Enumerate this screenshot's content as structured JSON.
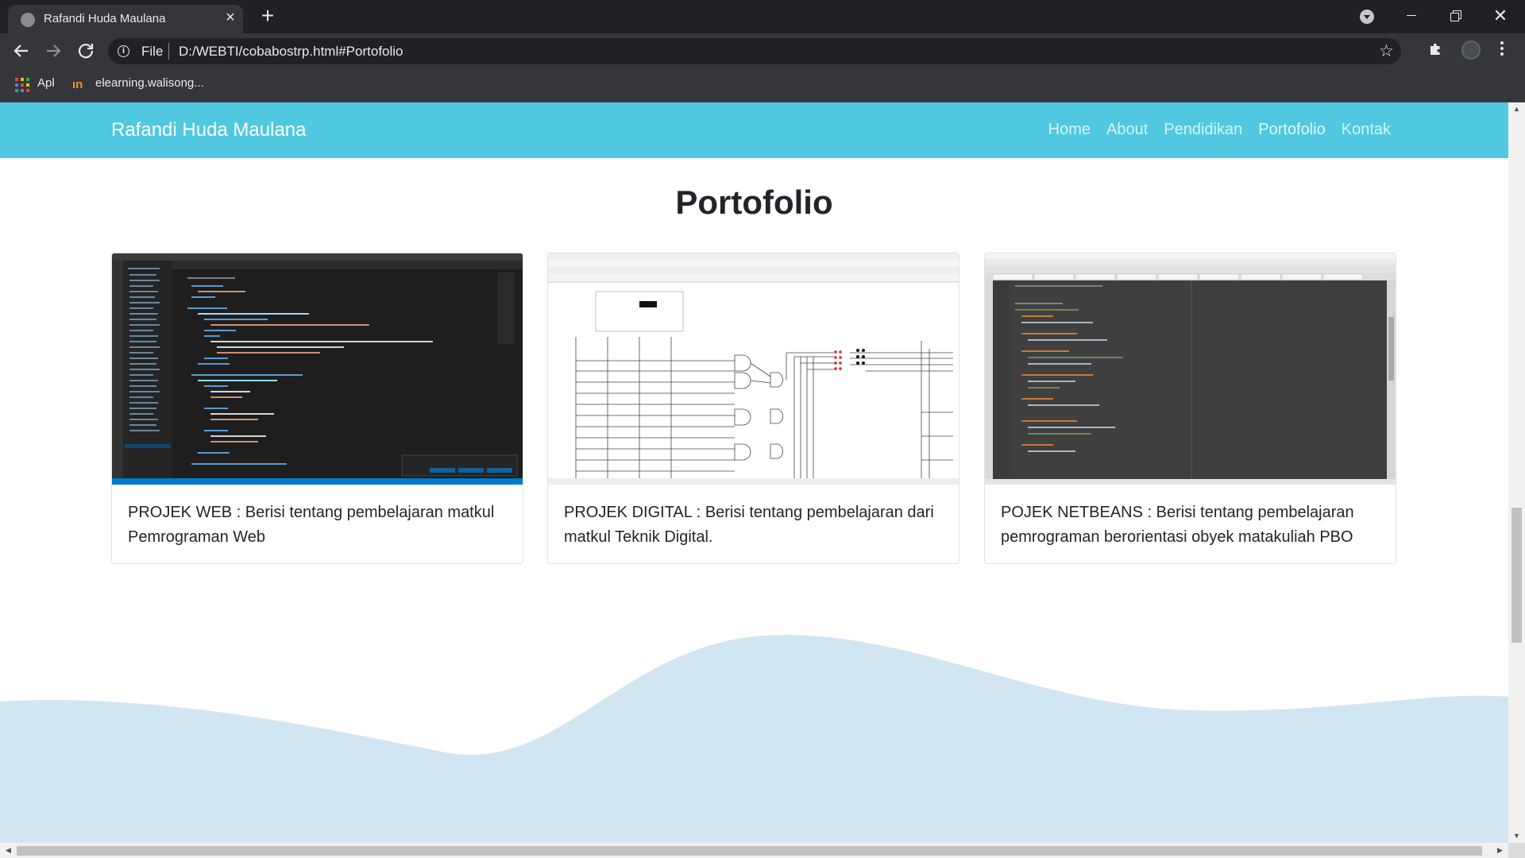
{
  "browser": {
    "tab_title": "Rafandi Huda Maulana",
    "tab_close_glyph": "×",
    "new_tab_glyph": "+",
    "url_scheme": "File",
    "url": "D:/WEBTI/cobabostrp.html#Portofolio",
    "bookmarks": {
      "apps_label": "Apl",
      "site_label": "elearning.walisong..."
    }
  },
  "page": {
    "brand": "Rafandi Huda Maulana",
    "nav": [
      {
        "label": "Home"
      },
      {
        "label": "About"
      },
      {
        "label": "Pendidikan"
      },
      {
        "label": "Portofolio"
      },
      {
        "label": "Kontak"
      }
    ],
    "section_title": "Portofolio",
    "cards": [
      {
        "text": "PROJEK WEB : Berisi tentang pembelajaran matkul Pemrograman Web",
        "image": "vscode-screenshot"
      },
      {
        "text": "PROJEK DIGITAL : Berisi tentang pembelajaran dari matkul Teknik Digital.",
        "image": "digital-circuit-screenshot"
      },
      {
        "text": "POJEK NETBEANS : Berisi tentang pembelajaran pemrograman berorientasi obyek matakuliah PBO",
        "image": "netbeans-screenshot"
      }
    ],
    "colors": {
      "navbar": "#50c8e0",
      "wave": "#d1e6f2"
    }
  },
  "icons": [
    "favicon",
    "close-icon",
    "plus-icon",
    "back-icon",
    "forward-icon",
    "reload-icon",
    "info-icon",
    "star-icon",
    "puzzle-icon",
    "avatar",
    "menu-icon",
    "apps-icon"
  ]
}
